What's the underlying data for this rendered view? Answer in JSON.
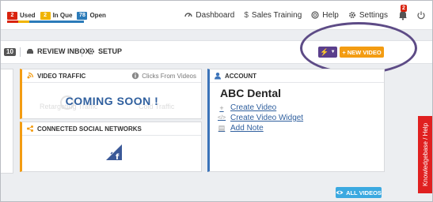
{
  "status": [
    {
      "count": "2",
      "label": "Used",
      "color": "#d9230f"
    },
    {
      "count": "2",
      "label": "In Que",
      "color": "#f0b400"
    },
    {
      "count": "78",
      "label": "Open",
      "color": "#2b7bb9"
    }
  ],
  "statusbar_colors": [
    "#d9230f",
    "#f0b400",
    "#2b7bb9"
  ],
  "nav": {
    "dashboard": "Dashboard",
    "sales_training": "Sales Training",
    "help": "Help",
    "settings": "Settings",
    "notifications_count": "2"
  },
  "toolbar": {
    "count": "10",
    "review_inbox": "REVIEW INBOX",
    "setup": "SETUP",
    "new_video": "NEW VIDEO"
  },
  "traffic": {
    "title": "VIDEO TRAFFIC",
    "clicks_label": "Clicks From Videos",
    "coming_soon": "COMING SOON !",
    "ghost_left": "Retargeting Traffic",
    "ghost_right": "Cold Traffic"
  },
  "social": {
    "title": "CONNECTED SOCIAL NETWORKS"
  },
  "account": {
    "header": "ACCOUNT",
    "name": "ABC Dental",
    "links": [
      "Create Video",
      "Create Video Widget",
      "Add Note"
    ]
  },
  "all_videos": "ALL VIDEOS",
  "knowledgebase": "Knowledgebase / Help",
  "colors": {
    "accent_orange": "#f39c12",
    "accent_purple": "#5b3f8c",
    "accent_blue": "#3ba9e0",
    "help_red": "#e02020"
  }
}
